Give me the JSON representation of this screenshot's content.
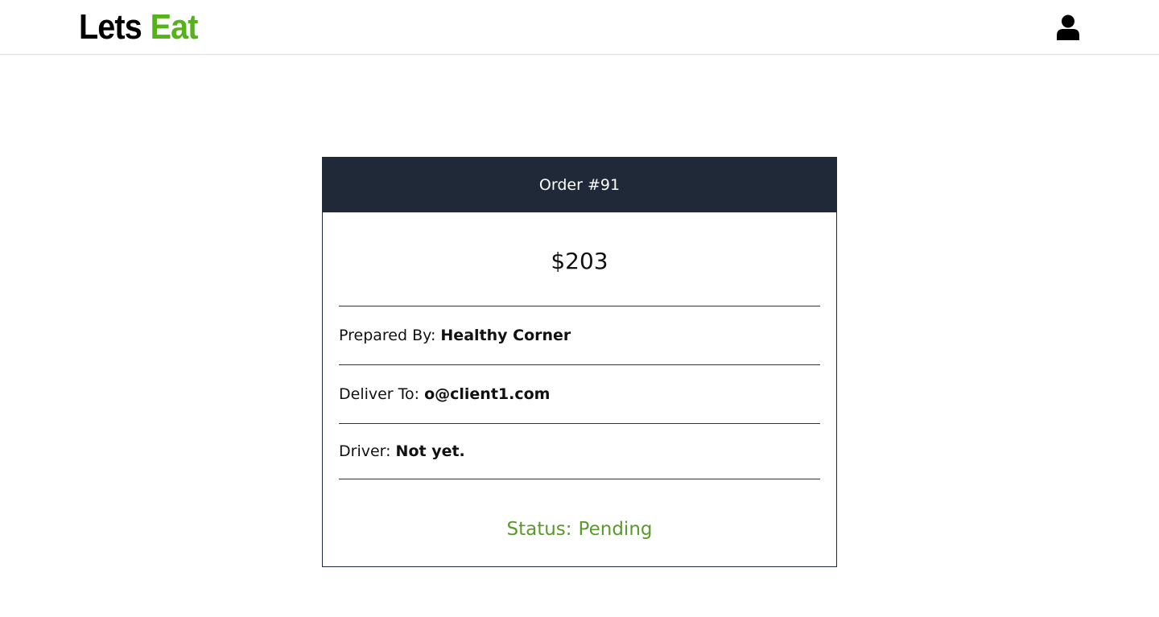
{
  "header": {
    "logo_word1": "Lets",
    "logo_word2": "Eat",
    "brand_color": "#56b21b",
    "user_icon": "user-icon"
  },
  "order": {
    "title": "Order #91",
    "total": "$203",
    "prepared_by_label": "Prepared By:",
    "prepared_by": "Healthy Corner",
    "deliver_to_label": "Deliver To:",
    "deliver_to": "o@client1.com",
    "driver_label": "Driver:",
    "driver": "Not yet.",
    "status_label": "Status:",
    "status": "Pending",
    "header_color": "#1f2937",
    "status_color": "#5a9a2a"
  }
}
